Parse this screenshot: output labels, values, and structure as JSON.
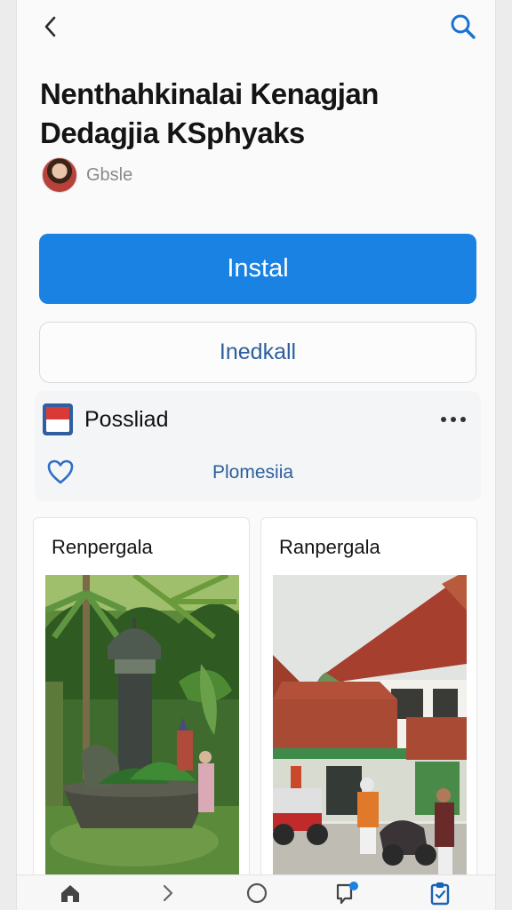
{
  "header": {
    "title_lines": [
      "Nenthahkinalai Kenagjan",
      "Dedagjia KSphyaks"
    ],
    "developer": "Gbsle"
  },
  "actions": {
    "primary_label": "Instal",
    "secondary_label": "Inedkall"
  },
  "info": {
    "label": "Possliad",
    "country": "Plomesiia"
  },
  "cards": [
    {
      "title": "Renpergala"
    },
    {
      "title": "Ranpergala"
    }
  ],
  "bottom_nav": [
    {
      "icon": "home-icon"
    },
    {
      "icon": "chevron-right-icon"
    },
    {
      "icon": "circle-icon"
    },
    {
      "icon": "notification-icon"
    },
    {
      "icon": "clipboard-icon"
    }
  ],
  "colors": {
    "accent": "#1a82e2",
    "link": "#2d5f9e",
    "flag_red": "#d93a36"
  }
}
